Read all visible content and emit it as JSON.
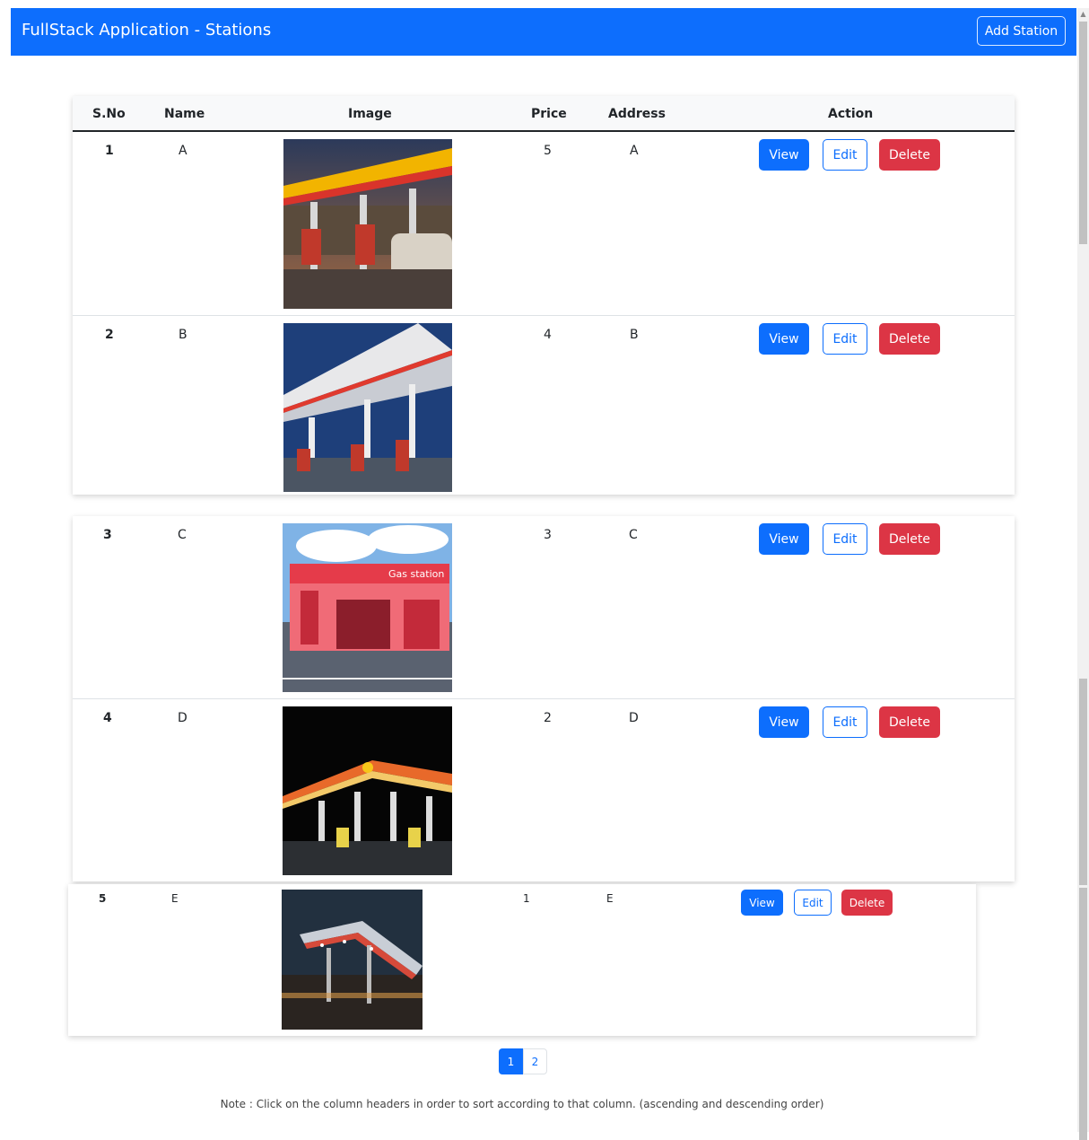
{
  "app": {
    "title": "FullStack Application - Stations",
    "add_button": "Add Station"
  },
  "table": {
    "headers": [
      "S.No",
      "Name",
      "Image",
      "Price",
      "Address",
      "Action"
    ],
    "rows": [
      {
        "sno": "1",
        "name": "A",
        "price": "5",
        "address": "A",
        "image": "gas-station-dusk-photo"
      },
      {
        "sno": "2",
        "name": "B",
        "price": "4",
        "address": "B",
        "image": "gas-station-canopy-photo"
      },
      {
        "sno": "3",
        "name": "C",
        "price": "3",
        "address": "C",
        "image": "gas-station-cartoon-illustration",
        "image_text": "Gas station"
      },
      {
        "sno": "4",
        "name": "D",
        "price": "2",
        "address": "D",
        "image": "gas-station-night-photo"
      },
      {
        "sno": "5",
        "name": "E",
        "price": "1",
        "address": "E",
        "image": "gas-station-evening-photo"
      }
    ],
    "actions": {
      "view": "View",
      "edit": "Edit",
      "delete": "Delete"
    }
  },
  "pagination": {
    "pages": [
      "1",
      "2"
    ],
    "current": "1"
  },
  "note": "Note : Click on the column headers in order to sort according to that column. (ascending and descending order)",
  "colors": {
    "primary": "#0d6efd",
    "danger": "#dc3545",
    "header_bg": "#f8f9fa"
  }
}
